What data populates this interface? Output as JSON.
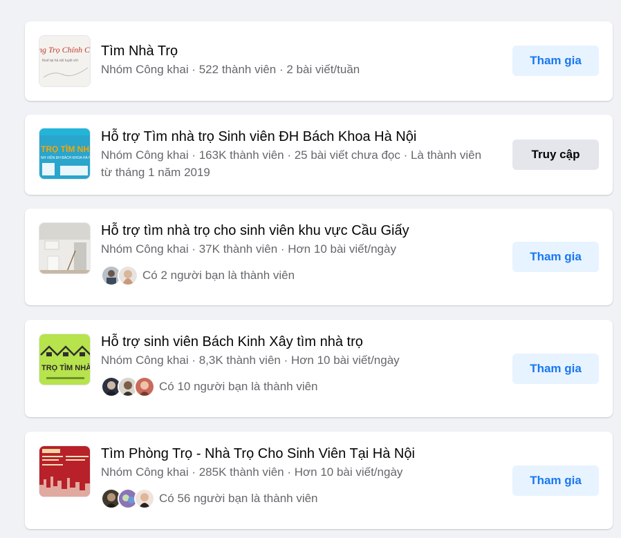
{
  "groups": [
    {
      "name": "Tìm Nhà Trọ",
      "meta": "Nhóm Công khai · 522 thành viên · 2 bài viết/tuần",
      "friends_text": "",
      "button_label": "Tham gia",
      "thumb_text": "ng Trọ Chính Ch"
    },
    {
      "name": "Hỗ trợ Tìm nhà trọ Sinh viên ĐH Bách Khoa Hà Nội",
      "meta": "Nhóm Công khai · 163K thành viên · 25 bài viết chưa đọc · Là thành viên từ tháng 1 năm 2019",
      "friends_text": "",
      "button_label": "Truy cập",
      "thumb_text": "TRỌ TÌM NHÀ T",
      "thumb_subtext": "NH VIÊN ĐH BÁCH KHOA HÀ NỘ"
    },
    {
      "name": "Hỗ trợ tìm nhà trọ cho sinh viên khu vực Cầu Giấy",
      "meta": "Nhóm Công khai · 37K thành viên · Hơn 10 bài viết/ngày",
      "friends_text": "Có 2 người bạn là thành viên",
      "button_label": "Tham gia"
    },
    {
      "name": "Hỗ trợ sinh viên Bách Kinh Xây tìm nhà trọ",
      "meta": "Nhóm Công khai · 8,3K thành viên · Hơn 10 bài viết/ngày",
      "friends_text": "Có 10 người bạn là thành viên",
      "button_label": "Tham gia",
      "thumb_text": "TRỌ TÌM NHÀ T"
    },
    {
      "name": "Tìm Phòng Trọ - Nhà Trọ Cho Sinh Viên Tại Hà Nội",
      "meta": "Nhóm Công khai · 285K thành viên · Hơn 10 bài viết/ngày",
      "friends_text": "Có 56 người bạn là thành viên",
      "button_label": "Tham gia"
    }
  ],
  "colors": {
    "join_bg": "#e7f3ff",
    "join_text": "#1877f2",
    "visit_bg": "#e4e6eb",
    "page_bg": "#f0f2f5"
  }
}
